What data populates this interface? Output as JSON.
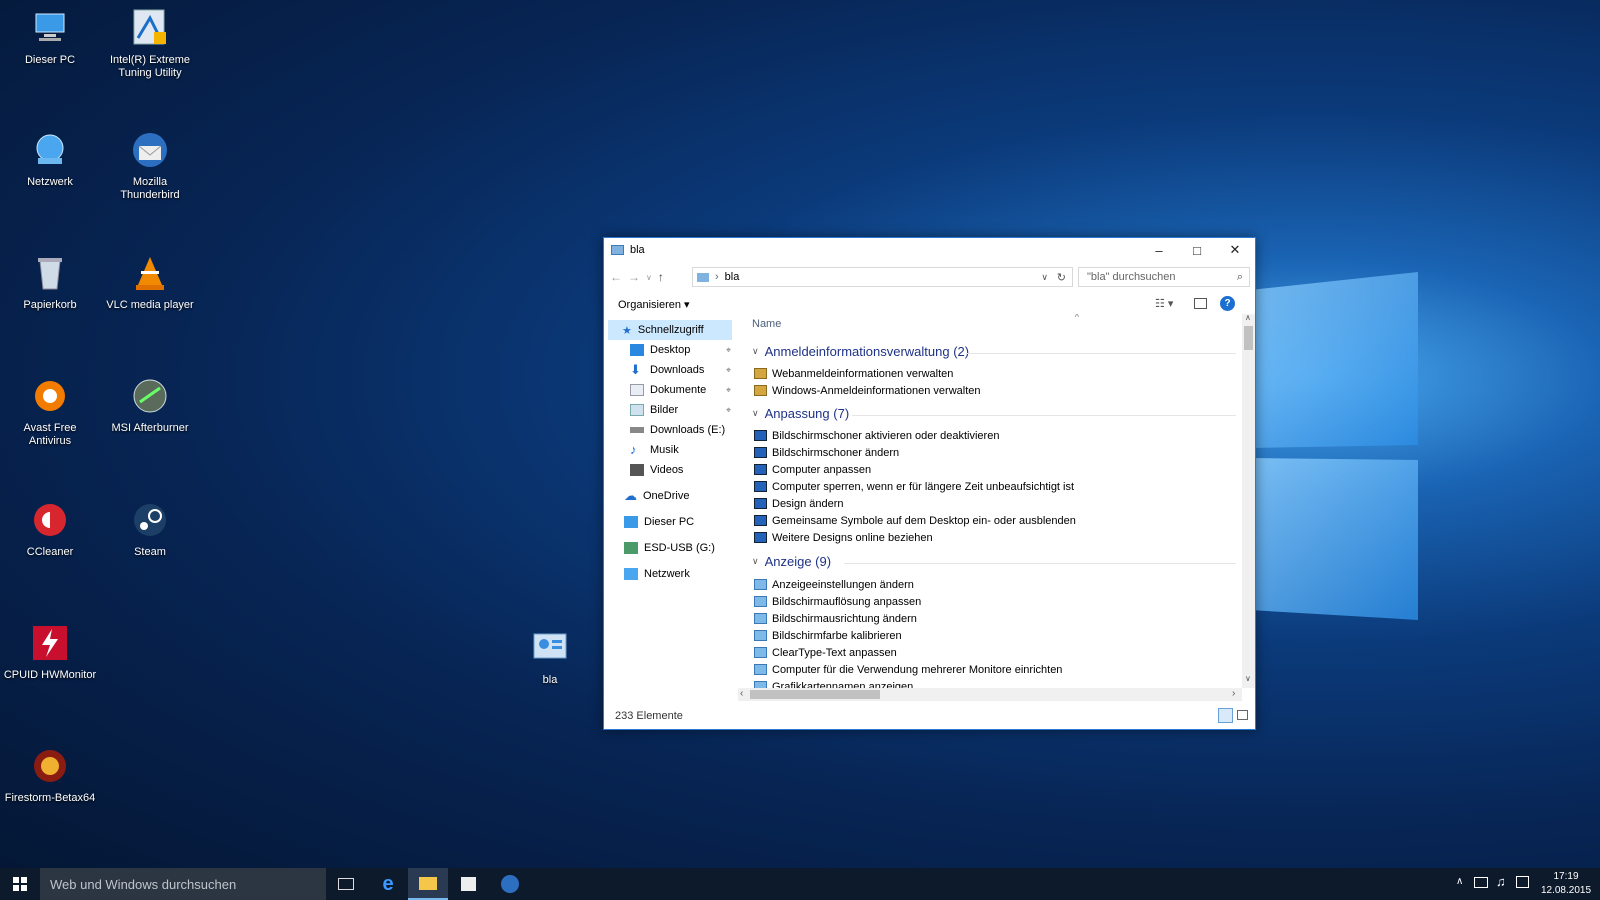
{
  "desktop_icons": [
    {
      "label": "Dieser PC",
      "icon": "computer-icon"
    },
    {
      "label": "Intel(R) Extreme Tuning Utility",
      "icon": "intel-xtu-icon"
    },
    {
      "label": "Netzwerk",
      "icon": "network-icon"
    },
    {
      "label": "Mozilla Thunderbird",
      "icon": "thunderbird-icon"
    },
    {
      "label": "Papierkorb",
      "icon": "recycle-bin-icon"
    },
    {
      "label": "VLC media player",
      "icon": "vlc-icon"
    },
    {
      "label": "Avast Free Antivirus",
      "icon": "avast-icon"
    },
    {
      "label": "MSI Afterburner",
      "icon": "msi-afterburner-icon"
    },
    {
      "label": "CCleaner",
      "icon": "ccleaner-icon"
    },
    {
      "label": "Steam",
      "icon": "steam-icon"
    },
    {
      "label": "CPUID HWMonitor",
      "icon": "hwmonitor-icon"
    },
    {
      "label": "Firestorm-Betax64",
      "icon": "firestorm-icon"
    },
    {
      "label": "bla",
      "icon": "control-panel-icon"
    }
  ],
  "window": {
    "title": "bla",
    "address": "bla",
    "search_placeholder": "\"bla\" durchsuchen",
    "organize_label": "Organisieren",
    "column_name": "Name",
    "status": "233 Elemente",
    "nav": {
      "quick_access": "Schnellzugriff",
      "items": [
        "Desktop",
        "Downloads",
        "Dokumente",
        "Bilder",
        "Downloads (E:)",
        "Musik",
        "Videos"
      ],
      "onedrive": "OneDrive",
      "this_pc": "Dieser PC",
      "usb": "ESD-USB (G:)",
      "network": "Netzwerk"
    },
    "groups": [
      {
        "title": "Anmeldeinformationsverwaltung (2)",
        "items": [
          "Webanmeldeinformationen verwalten",
          "Windows-Anmeldeinformationen verwalten"
        ]
      },
      {
        "title": "Anpassung (7)",
        "items": [
          "Bildschirmschoner aktivieren oder deaktivieren",
          "Bildschirmschoner ändern",
          "Computer anpassen",
          "Computer sperren, wenn er für längere Zeit unbeaufsichtigt ist",
          "Design ändern",
          "Gemeinsame Symbole auf dem Desktop ein- oder ausblenden",
          "Weitere Designs online beziehen"
        ]
      },
      {
        "title": "Anzeige (9)",
        "items": [
          "Anzeigeeinstellungen ändern",
          "Bildschirmauflösung anpassen",
          "Bildschirmausrichtung ändern",
          "Bildschirmfarbe kalibrieren",
          "ClearType-Text anpassen",
          "Computer für die Verwendung mehrerer Monitore einrichten",
          "Grafikkartennamen anzeigen"
        ]
      }
    ]
  },
  "taskbar": {
    "search_placeholder": "Web und Windows durchsuchen",
    "time": "17:19",
    "date": "12.08.2015"
  },
  "colors": {
    "accent": "#1e3287",
    "selection": "#cce8ff",
    "taskbar": "#0d1a2c",
    "window_border": "#2b79d0"
  }
}
